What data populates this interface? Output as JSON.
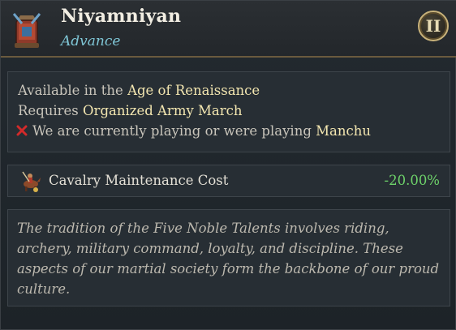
{
  "header": {
    "title": "Niyamniyan",
    "subtitle": "Advance",
    "tier_badge": "II",
    "icon": "advance-emblem-icon"
  },
  "requirements": {
    "line1_prefix": "Available in the ",
    "line1_value": "Age of Renaissance",
    "line2_prefix": "Requires ",
    "line2_value": "Organized Army March",
    "line3_icon": "red-cross-icon",
    "line3_prefix": "We are currently playing or were playing ",
    "line3_value": "Manchu"
  },
  "modifier": {
    "icon": "cavalry-icon",
    "label": "Cavalry Maintenance Cost",
    "value": "-20.00%"
  },
  "description": {
    "text": "The tradition of the Five Noble Talents involves riding, archery, military command, loyalty, and discipline. These aspects of our martial society form the backbone of our proud culture."
  },
  "colors": {
    "highlight": "#f3e6b0",
    "subtitle": "#7fc6d6",
    "positive": "#6ed36a",
    "failure": "#d22a2a"
  }
}
